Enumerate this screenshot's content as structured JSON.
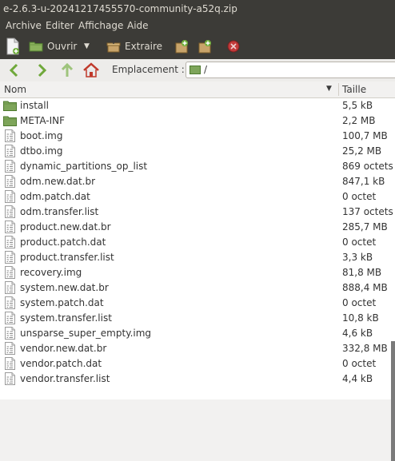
{
  "window": {
    "title": "e-2.6.3-u-20241217455570-community-a52q.zip"
  },
  "menu": [
    "Archive",
    "Editer",
    "Affichage",
    "Aide"
  ],
  "toolbar": {
    "open_label": "Ouvrir",
    "extract_label": "Extraire"
  },
  "location": {
    "label": "Emplacement :",
    "path": "/"
  },
  "columns": {
    "name": "Nom",
    "size": "Taille"
  },
  "files": [
    {
      "name": "install",
      "size": "5,5 kB",
      "type": "folder"
    },
    {
      "name": "META-INF",
      "size": "2,2 MB",
      "type": "folder"
    },
    {
      "name": "boot.img",
      "size": "100,7 MB",
      "type": "file"
    },
    {
      "name": "dtbo.img",
      "size": "25,2 MB",
      "type": "file"
    },
    {
      "name": "dynamic_partitions_op_list",
      "size": "869 octets",
      "type": "file"
    },
    {
      "name": "odm.new.dat.br",
      "size": "847,1 kB",
      "type": "file"
    },
    {
      "name": "odm.patch.dat",
      "size": "0 octet",
      "type": "file"
    },
    {
      "name": "odm.transfer.list",
      "size": "137 octets",
      "type": "file"
    },
    {
      "name": "product.new.dat.br",
      "size": "285,7 MB",
      "type": "file"
    },
    {
      "name": "product.patch.dat",
      "size": "0 octet",
      "type": "file"
    },
    {
      "name": "product.transfer.list",
      "size": "3,3 kB",
      "type": "file"
    },
    {
      "name": "recovery.img",
      "size": "81,8 MB",
      "type": "file"
    },
    {
      "name": "system.new.dat.br",
      "size": "888,4 MB",
      "type": "file"
    },
    {
      "name": "system.patch.dat",
      "size": "0 octet",
      "type": "file"
    },
    {
      "name": "system.transfer.list",
      "size": "10,8 kB",
      "type": "file"
    },
    {
      "name": "unsparse_super_empty.img",
      "size": "4,6 kB",
      "type": "file"
    },
    {
      "name": "vendor.new.dat.br",
      "size": "332,8 MB",
      "type": "file"
    },
    {
      "name": "vendor.patch.dat",
      "size": "0 octet",
      "type": "file"
    },
    {
      "name": "vendor.transfer.list",
      "size": "4,4 kB",
      "type": "file"
    }
  ]
}
